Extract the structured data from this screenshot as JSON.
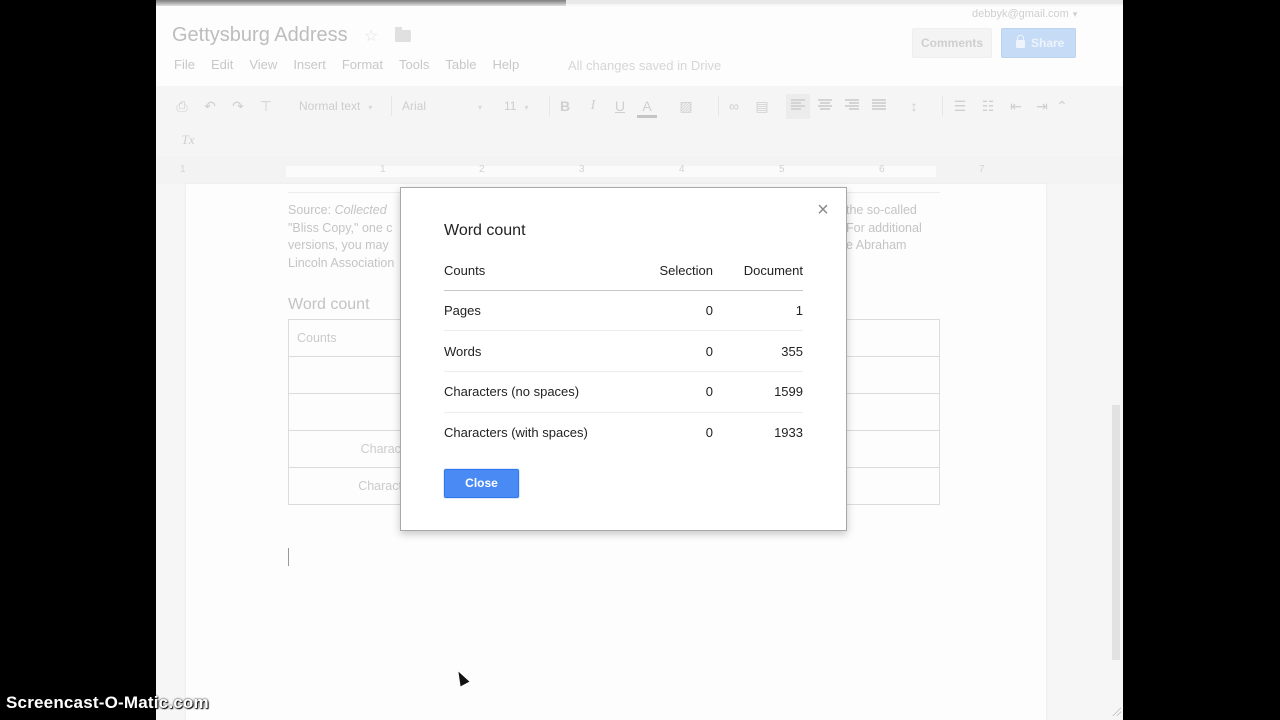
{
  "header": {
    "doc_title": "Gettysburg Address",
    "account": "debbyk@gmail.com",
    "comments_label": "Comments",
    "share_label": "Share",
    "save_status": "All changes saved in Drive"
  },
  "menu": [
    "File",
    "Edit",
    "View",
    "Insert",
    "Format",
    "Tools",
    "Table",
    "Help"
  ],
  "toolbar": {
    "style": "Normal text",
    "font": "Arial",
    "size": "11",
    "bold": "B",
    "italic": "I",
    "underline": "U",
    "text_color": "A",
    "clear_format": "Tx"
  },
  "ruler": {
    "numbers": [
      "1",
      "1",
      "2",
      "3",
      "4",
      "5",
      "6",
      "7"
    ]
  },
  "document": {
    "source_lines_left": [
      "Source: ",
      "Collected",
      "\"Bliss Copy,\" one c",
      "versions, you may",
      "Lincoln Association"
    ],
    "source_lines_right": [
      "the so-called",
      "For additional",
      "e Abraham"
    ],
    "heading": "Word count",
    "table_rows": [
      "Counts",
      "",
      "",
      "Characters (n",
      "Characters (wi"
    ]
  },
  "dialog": {
    "title": "Word count",
    "columns": [
      "Counts",
      "Selection",
      "Document"
    ],
    "rows": [
      {
        "label": "Pages",
        "selection": "0",
        "document": "1"
      },
      {
        "label": "Words",
        "selection": "0",
        "document": "355"
      },
      {
        "label": "Characters (no spaces)",
        "selection": "0",
        "document": "1599"
      },
      {
        "label": "Characters (with spaces)",
        "selection": "0",
        "document": "1933"
      }
    ],
    "close_label": "Close",
    "accent": "#4a8af4"
  },
  "watermark": "Screencast-O-Matic.com"
}
